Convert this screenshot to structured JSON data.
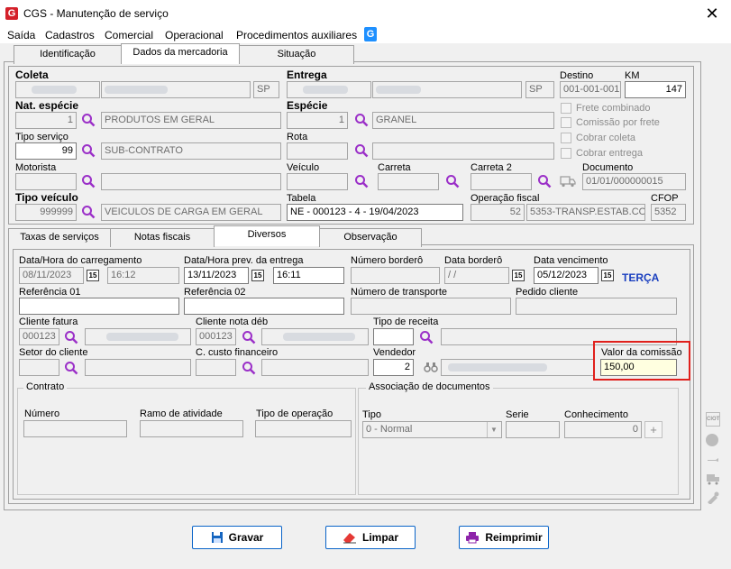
{
  "window": {
    "title": "CGS - Manutenção de serviço",
    "close": "✕",
    "logo": "G"
  },
  "menu": {
    "items": [
      "Saída",
      "Cadastros",
      "Comercial",
      "Operacional",
      "Procedimentos auxiliares"
    ],
    "help_icon": "G"
  },
  "top_tabs": [
    "Identificação",
    "Dados da mercadoria",
    "Situação"
  ],
  "header": {
    "coleta": {
      "label": "Coleta",
      "uf": "SP"
    },
    "entrega": {
      "label": "Entrega",
      "uf": "SP"
    },
    "destino": {
      "label": "Destino",
      "value": "001-001-001"
    },
    "km": {
      "label": "KM",
      "value": "147"
    },
    "nat_especie": {
      "label": "Nat. espécie",
      "code": "1",
      "desc": "PRODUTOS EM GERAL"
    },
    "especie": {
      "label": "Espécie",
      "code": "1",
      "desc": "GRANEL"
    },
    "checkboxes": [
      "Frete combinado",
      "Comissão por frete",
      "Cobrar coleta",
      "Cobrar entrega"
    ],
    "tipo_servico": {
      "label": "Tipo serviço",
      "code": "99",
      "desc": "SUB-CONTRATO"
    },
    "rota": {
      "label": "Rota"
    },
    "motorista": {
      "label": "Motorista"
    },
    "veiculo": {
      "label": "Veículo"
    },
    "carreta": {
      "label": "Carreta"
    },
    "carreta2": {
      "label": "Carreta 2"
    },
    "documento": {
      "label": "Documento",
      "value": "01/01/000000015"
    },
    "tipo_veiculo": {
      "label": "Tipo veículo",
      "code": "999999",
      "desc": "VEICULOS DE CARGA EM GERAL"
    },
    "tabela": {
      "label": "Tabela",
      "value": "NE - 000123 - 4 - 19/04/2023"
    },
    "operacao_fiscal": {
      "label": "Operação fiscal",
      "code": "52",
      "desc": "5353-TRANSP.ESTAB.CO"
    },
    "cfop": {
      "label": "CFOP",
      "value": "5352"
    }
  },
  "sub_tabs": [
    "Taxas de serviços",
    "Notas fiscais",
    "Diversos",
    "Observação"
  ],
  "diversos": {
    "data_carregamento": {
      "label": "Data/Hora do carregamento",
      "date": "08/11/2023",
      "time": "16:12"
    },
    "data_entrega": {
      "label": "Data/Hora prev. da entrega",
      "date": "13/11/2023",
      "time": "16:11"
    },
    "numero_bordero": {
      "label": "Número borderô"
    },
    "data_bordero": {
      "label": "Data borderô",
      "value": " / /"
    },
    "data_vencimento": {
      "label": "Data vencimento",
      "value": "05/12/2023",
      "weekday": "TERÇA"
    },
    "referencia1": {
      "label": "Referência 01"
    },
    "referencia2": {
      "label": "Referência 02"
    },
    "numero_transporte": {
      "label": "Número de transporte"
    },
    "pedido_cliente": {
      "label": "Pedido cliente"
    },
    "cliente_fatura": {
      "label": "Cliente fatura",
      "code": "000123"
    },
    "cliente_nota_deb": {
      "label": "Cliente nota déb",
      "code": "000123"
    },
    "tipo_receita": {
      "label": "Tipo de receita"
    },
    "setor_cliente": {
      "label": "Setor do cliente"
    },
    "custo_financeiro": {
      "label": "C. custo financeiro"
    },
    "vendedor": {
      "label": "Vendedor",
      "code": "2"
    },
    "valor_comissao": {
      "label": "Valor da comissão",
      "value": "150,00"
    },
    "contrato": {
      "title": "Contrato",
      "numero": "Número",
      "ramo": "Ramo de atividade",
      "tipo_operacao": "Tipo de operação"
    },
    "associacao": {
      "title": "Associação de documentos",
      "tipo_label": "Tipo",
      "tipo_value": "0 - Normal",
      "serie": "Serie",
      "conhecimento": "Conhecimento",
      "conhecimento_value": "0"
    }
  },
  "calendar_icon_text": "15",
  "buttons": {
    "gravar": "Gravar",
    "limpar": "Limpar",
    "reimprimir": "Reimprimir"
  },
  "side_icon_label": "CIOT"
}
